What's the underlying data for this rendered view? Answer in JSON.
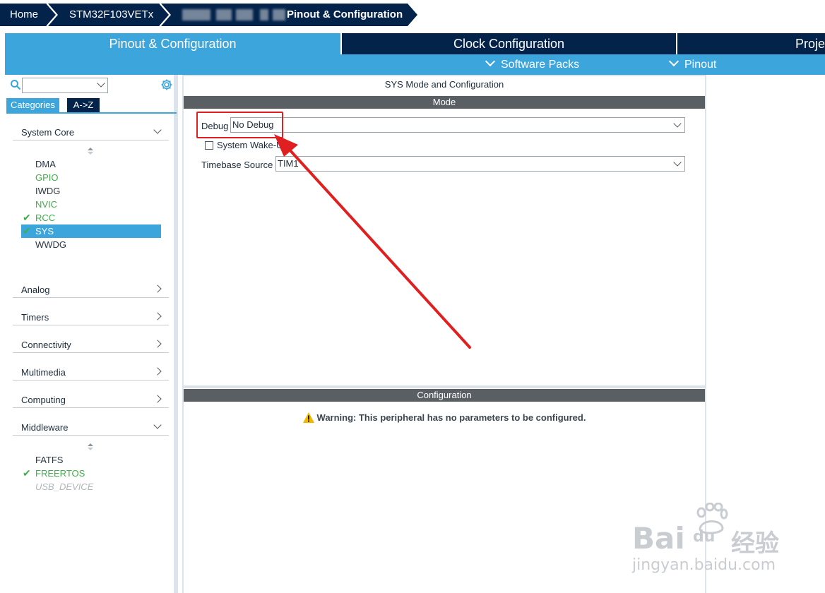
{
  "breadcrumb": {
    "home": "Home",
    "device": "STM32F103VETx",
    "current": "Pinout & Configuration"
  },
  "tabs": {
    "pinout": "Pinout & Configuration",
    "clock": "Clock Configuration",
    "project": "Proje"
  },
  "subbar": {
    "software_packs": "Software Packs",
    "pinout": "Pinout"
  },
  "sidebar": {
    "search_value": "",
    "view_tabs": [
      "Categories",
      "A->Z"
    ],
    "categories": {
      "system_core": "System Core",
      "analog": "Analog",
      "timers": "Timers",
      "connectivity": "Connectivity",
      "multimedia": "Multimedia",
      "computing": "Computing",
      "middleware": "Middleware"
    },
    "system_core_items": [
      {
        "label": "DMA",
        "state": "plain"
      },
      {
        "label": "GPIO",
        "state": "green"
      },
      {
        "label": "IWDG",
        "state": "plain"
      },
      {
        "label": "NVIC",
        "state": "green"
      },
      {
        "label": "RCC",
        "state": "checked"
      },
      {
        "label": "SYS",
        "state": "selected"
      },
      {
        "label": "WWDG",
        "state": "plain"
      }
    ],
    "middleware_items": [
      {
        "label": "FATFS",
        "state": "plain"
      },
      {
        "label": "FREERTOS",
        "state": "checked"
      },
      {
        "label": "USB_DEVICE",
        "state": "disabled"
      }
    ]
  },
  "mode_panel": {
    "title": "SYS Mode and Configuration",
    "section": "Mode",
    "debug_label": "Debug",
    "debug_value": "No Debug",
    "wakeup_label": "System Wake-Up",
    "timebase_label": "Timebase Source",
    "timebase_value": "TIM1"
  },
  "config_panel": {
    "section": "Configuration",
    "warning": "Warning: This peripheral has no parameters to be configured."
  },
  "watermark": {
    "brand": "Bai",
    "brand_cn": "经验",
    "url": "jingyan.baidu.com"
  },
  "colors": {
    "navy": "#03234b",
    "accent": "#3ca5dc",
    "green": "#3fae49",
    "annotation": "#e02020"
  }
}
